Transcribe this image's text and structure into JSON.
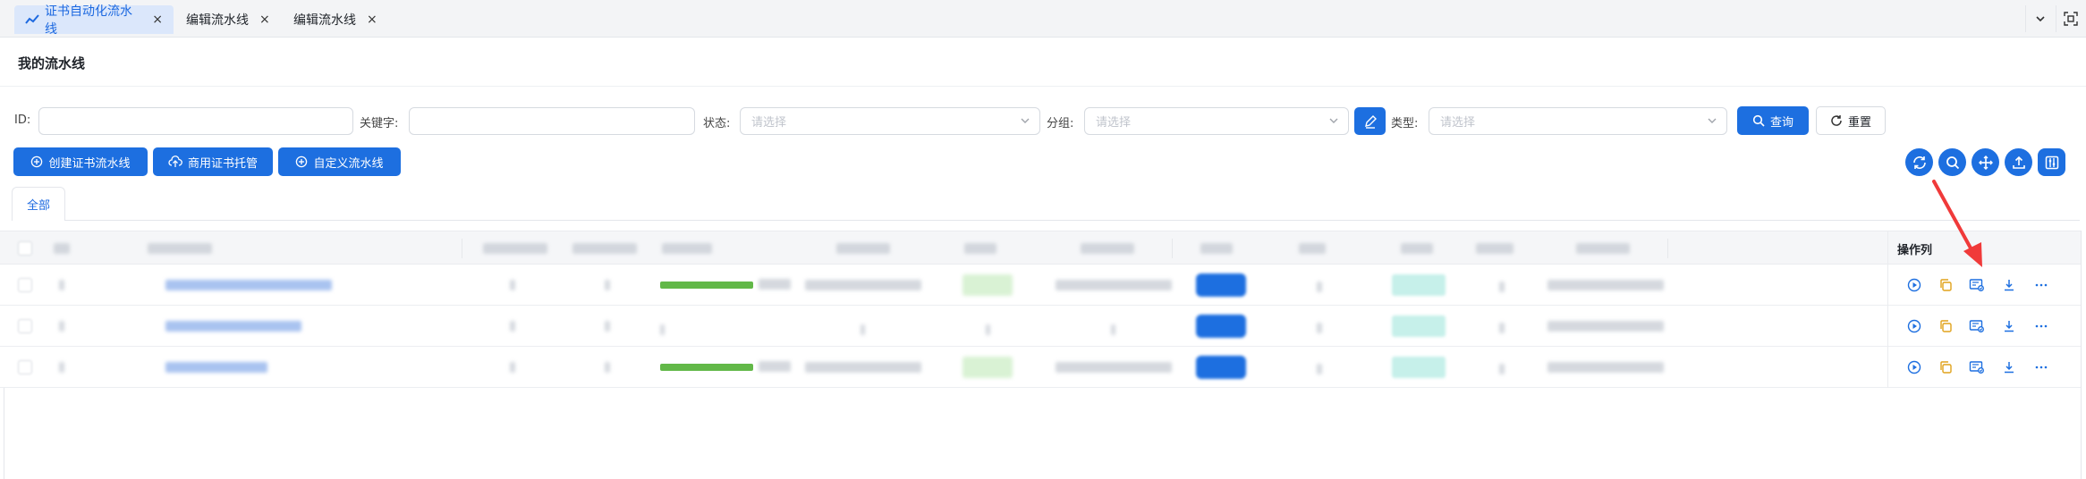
{
  "tabs": [
    {
      "label": "证书自动化流水线",
      "active": true
    },
    {
      "label": "编辑流水线",
      "active": false
    },
    {
      "label": "编辑流水线",
      "active": false
    }
  ],
  "tab_close": "×",
  "page_title": "我的流水线",
  "filters": {
    "id_label": "ID:",
    "keyword_label": "关键字:",
    "status_label": "状态:",
    "status_placeholder": "请选择",
    "group_label": "分组:",
    "group_placeholder": "请选择",
    "type_label": "类型:",
    "type_placeholder": "请选择",
    "search_label": "查询",
    "reset_label": "重置"
  },
  "actions": {
    "create_label": "创建证书流水线",
    "hosting_label": "商用证书托管",
    "custom_label": "自定义流水线"
  },
  "sub_tabs": [
    "全部"
  ],
  "table": {
    "op_header": "操作列",
    "rows": 3
  },
  "colors": {
    "primary": "#1d6fe0",
    "progress": "#62b848",
    "annotation_arrow": "#f03a3a"
  }
}
